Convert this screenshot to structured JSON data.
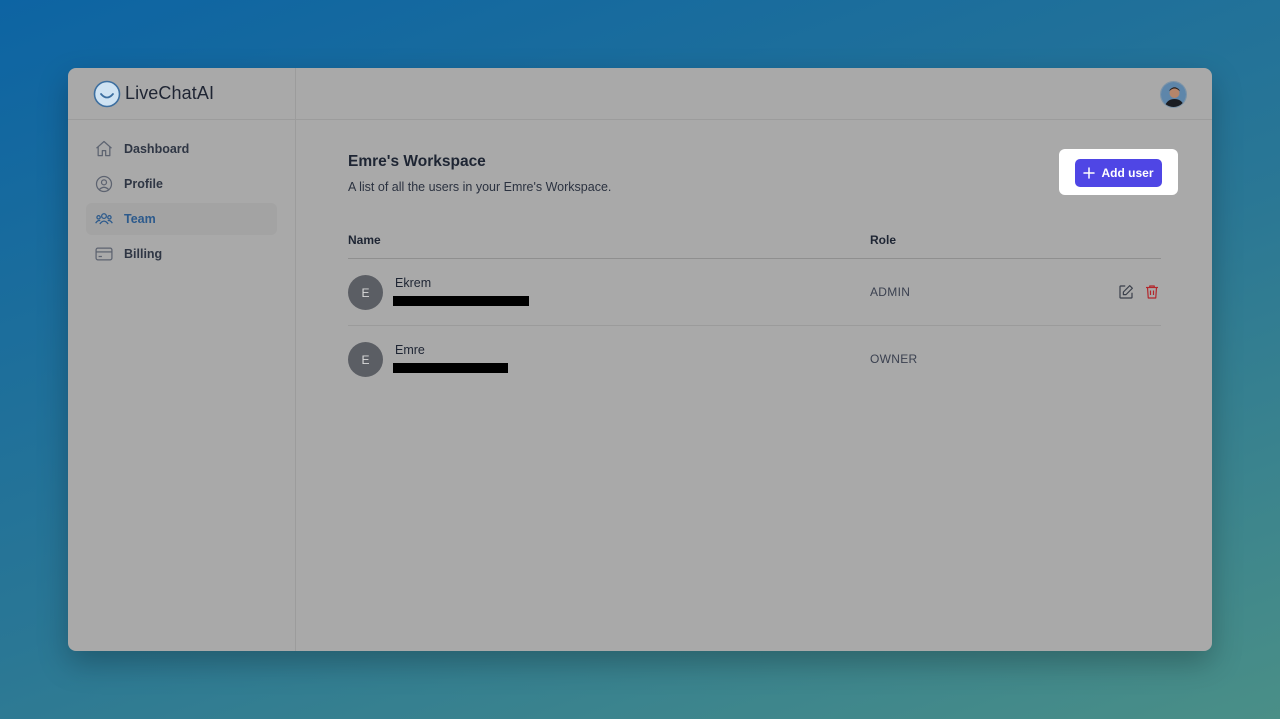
{
  "app": {
    "logo_text": "LiveChatAI",
    "brand_color": "#4f46e5"
  },
  "sidebar": {
    "items": [
      {
        "label": "Dashboard",
        "icon": "home-icon",
        "active": false
      },
      {
        "label": "Profile",
        "icon": "user-circle-icon",
        "active": false
      },
      {
        "label": "Team",
        "icon": "users-icon",
        "active": true
      },
      {
        "label": "Billing",
        "icon": "credit-card-icon",
        "active": false
      }
    ]
  },
  "header": {
    "avatar_icon": "user-avatar"
  },
  "workspace": {
    "title": "Emre's Workspace",
    "description": "A list of all the users in your Emre's Workspace.",
    "add_user_label": "Add user"
  },
  "table": {
    "columns": [
      "Name",
      "Role"
    ],
    "rows": [
      {
        "initial": "E",
        "name": "Ekrem",
        "role": "ADMIN",
        "editable": true
      },
      {
        "initial": "E",
        "name": "Emre",
        "role": "OWNER",
        "editable": false
      }
    ]
  }
}
